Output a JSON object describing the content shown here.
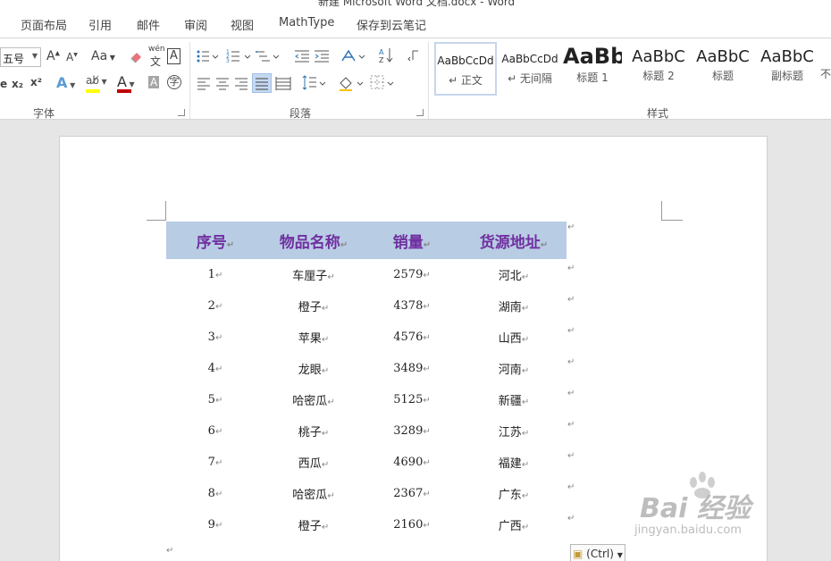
{
  "window": {
    "title": "新建 Microsoft Word 文档.docx - Word"
  },
  "menu_tabs": [
    "页面布局",
    "引用",
    "邮件",
    "审阅",
    "视图",
    "MathType",
    "保存到云笔记"
  ],
  "ribbon": {
    "font_group": {
      "label": "字体",
      "font_size": "五号",
      "aa_label": "Aa",
      "wen_top": "wén",
      "wen_char": "文",
      "a_box": "A",
      "subscript": "x₂",
      "superscript": "x²",
      "e_fragment": "e",
      "char_shade": "A",
      "enclosed_char": "字",
      "highlight_color": "#ffff00",
      "font_color": "#c00000"
    },
    "paragraph_group": {
      "label": "段落"
    },
    "styles_group": {
      "label": "样式",
      "styles": [
        {
          "sample": "AaBbCcDd",
          "name": "↵ 正文"
        },
        {
          "sample": "AaBbCcDd",
          "name": "↵ 无间隔"
        },
        {
          "sample": "AaBb",
          "name": "标题 1"
        },
        {
          "sample": "AaBbC",
          "name": "标题 2"
        },
        {
          "sample": "AaBbC",
          "name": "标题"
        },
        {
          "sample": "AaBbC",
          "name": "副标题"
        },
        {
          "sample": "",
          "name": "不"
        }
      ]
    }
  },
  "document": {
    "paragraph_mark": "↵",
    "table": {
      "headers": [
        "序号",
        "物品名称",
        "销量",
        "货源地址"
      ],
      "rows": [
        [
          "1",
          "车厘子",
          "2579",
          "河北"
        ],
        [
          "2",
          "橙子",
          "4378",
          "湖南"
        ],
        [
          "3",
          "苹果",
          "4576",
          "山西"
        ],
        [
          "4",
          "龙眼",
          "3489",
          "河南"
        ],
        [
          "5",
          "哈密瓜",
          "5125",
          "新疆"
        ],
        [
          "6",
          "桃子",
          "3289",
          "江苏"
        ],
        [
          "7",
          "西瓜",
          "4690",
          "福建"
        ],
        [
          "8",
          "哈密瓜",
          "2367",
          "广东"
        ],
        [
          "9",
          "橙子",
          "2160",
          "广西"
        ]
      ],
      "header_bg": "#b8cce4",
      "header_color": "#7030a0"
    },
    "paste_options_label": "(Ctrl)"
  },
  "watermark": {
    "main": "Bai 经验",
    "sub": "jingyan.baidu.com"
  }
}
